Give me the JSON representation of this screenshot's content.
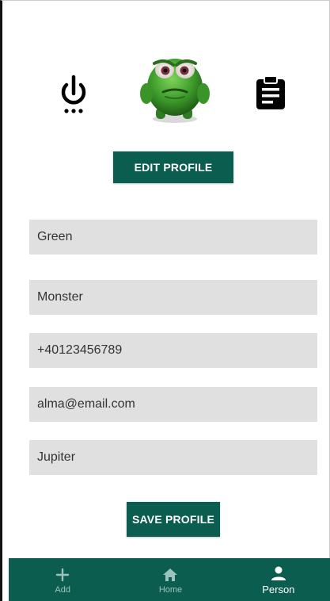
{
  "profile": {
    "edit_button_label": "EDIT PROFILE",
    "save_button_label": "SAVE PROFILE",
    "fields": [
      {
        "value": "Green"
      },
      {
        "value": "Monster"
      },
      {
        "value": "+40123456789"
      },
      {
        "value": "alma@email.com"
      },
      {
        "value": "Jupiter"
      }
    ]
  },
  "icons": {
    "power": "power-icon",
    "avatar": "green-monster-avatar",
    "clipboard": "clipboard-icon"
  },
  "bottom_nav": {
    "items": [
      {
        "label": "Add",
        "icon": "plus-icon",
        "active": false
      },
      {
        "label": "Home",
        "icon": "home-icon",
        "active": false
      },
      {
        "label": "Person",
        "icon": "person-icon",
        "active": true
      }
    ]
  },
  "colors": {
    "primary": "#0b5e4f",
    "field_background": "#e0e0e0",
    "nav_inactive": "#9cc3bb",
    "nav_active": "#ffffff"
  }
}
